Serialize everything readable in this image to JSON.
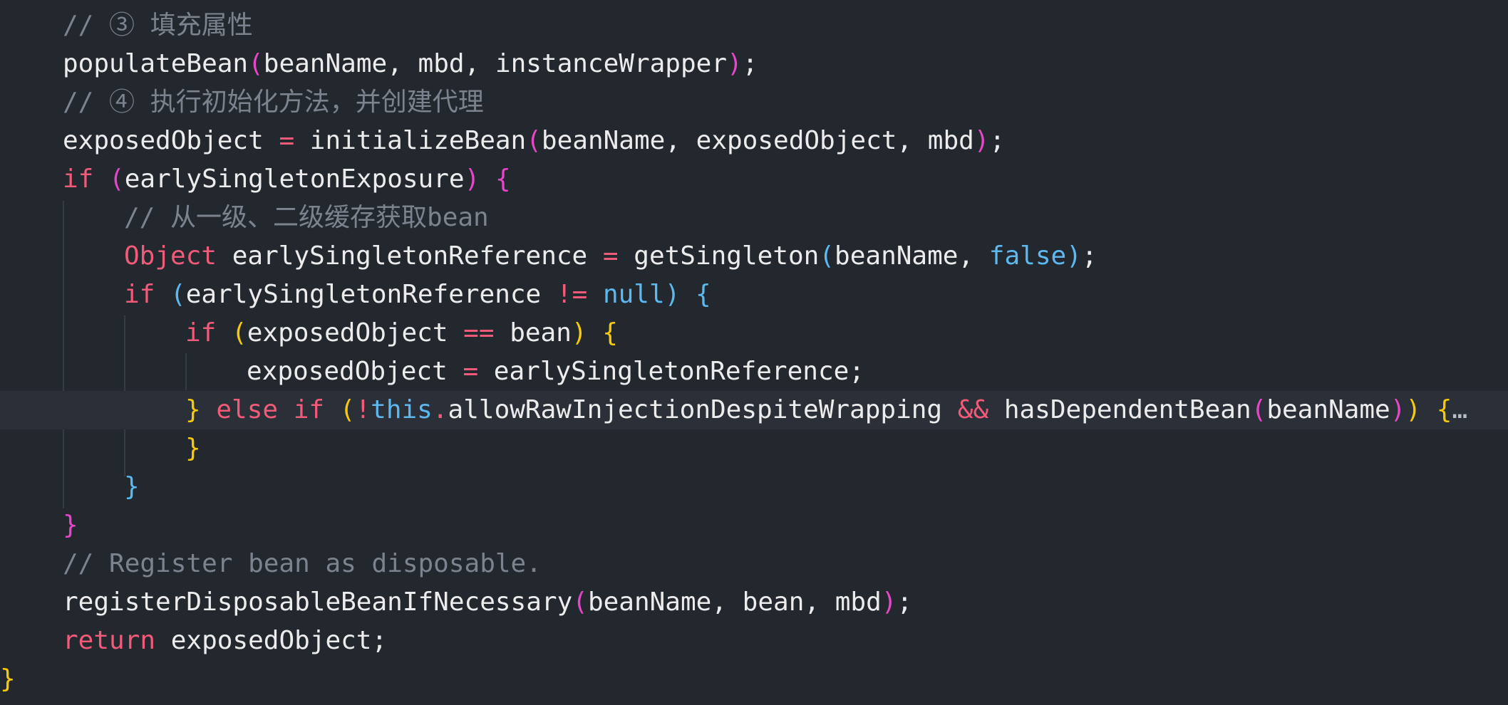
{
  "colors": {
    "background": "#23272e",
    "keyword": "#f25a79",
    "text": "#ececec",
    "comment": "#7c838f",
    "literal_blue": "#5cb8ef",
    "bracket_pink": "#e646c8",
    "bracket_yellow": "#f6c90e"
  },
  "code": {
    "lines": [
      {
        "indent": 88,
        "tokens": [
          {
            "t": "// ③ 填充属性",
            "c": "comment"
          }
        ]
      },
      {
        "indent": 88,
        "tokens": [
          {
            "t": "populateBean",
            "c": "default"
          },
          {
            "t": "(",
            "c": "pink"
          },
          {
            "t": "beanName, mbd, instanceWrapper",
            "c": "default"
          },
          {
            "t": ")",
            "c": "pink"
          },
          {
            "t": ";",
            "c": "default"
          }
        ]
      },
      {
        "indent": 88,
        "tokens": [
          {
            "t": "// ④ 执行初始化方法，并创建代理",
            "c": "comment"
          }
        ]
      },
      {
        "indent": 88,
        "tokens": [
          {
            "t": "exposedObject ",
            "c": "default"
          },
          {
            "t": "=",
            "c": "keyword"
          },
          {
            "t": " initializeBean",
            "c": "default"
          },
          {
            "t": "(",
            "c": "pink"
          },
          {
            "t": "beanName, exposedObject, mbd",
            "c": "default"
          },
          {
            "t": ")",
            "c": "pink"
          },
          {
            "t": ";",
            "c": "default"
          }
        ]
      },
      {
        "indent": 88,
        "tokens": [
          {
            "t": "if",
            "c": "keyword"
          },
          {
            "t": " ",
            "c": "default"
          },
          {
            "t": "(",
            "c": "pink"
          },
          {
            "t": "earlySingletonExposure",
            "c": "default"
          },
          {
            "t": ")",
            "c": "pink"
          },
          {
            "t": " ",
            "c": "default"
          },
          {
            "t": "{",
            "c": "pink"
          }
        ]
      },
      {
        "indent": 174,
        "tokens": [
          {
            "t": "// 从一级、二级缓存获取bean",
            "c": "comment"
          }
        ]
      },
      {
        "indent": 174,
        "tokens": [
          {
            "t": "Object",
            "c": "keyword"
          },
          {
            "t": " earlySingletonReference ",
            "c": "default"
          },
          {
            "t": "=",
            "c": "keyword"
          },
          {
            "t": " getSingleton",
            "c": "default"
          },
          {
            "t": "(",
            "c": "blue"
          },
          {
            "t": "beanName, ",
            "c": "default"
          },
          {
            "t": "false",
            "c": "blue"
          },
          {
            "t": ")",
            "c": "blue"
          },
          {
            "t": ";",
            "c": "default"
          }
        ]
      },
      {
        "indent": 174,
        "tokens": [
          {
            "t": "if",
            "c": "keyword"
          },
          {
            "t": " ",
            "c": "default"
          },
          {
            "t": "(",
            "c": "blue"
          },
          {
            "t": "earlySingletonReference ",
            "c": "default"
          },
          {
            "t": "!=",
            "c": "keyword"
          },
          {
            "t": " ",
            "c": "default"
          },
          {
            "t": "null",
            "c": "blue"
          },
          {
            "t": ")",
            "c": "blue"
          },
          {
            "t": " ",
            "c": "default"
          },
          {
            "t": "{",
            "c": "blue"
          }
        ]
      },
      {
        "indent": 260,
        "tokens": [
          {
            "t": "if",
            "c": "keyword"
          },
          {
            "t": " ",
            "c": "default"
          },
          {
            "t": "(",
            "c": "yellow"
          },
          {
            "t": "exposedObject ",
            "c": "default"
          },
          {
            "t": "==",
            "c": "keyword"
          },
          {
            "t": " bean",
            "c": "default"
          },
          {
            "t": ")",
            "c": "yellow"
          },
          {
            "t": " ",
            "c": "default"
          },
          {
            "t": "{",
            "c": "yellow"
          }
        ]
      },
      {
        "indent": 346,
        "tokens": [
          {
            "t": "exposedObject ",
            "c": "default"
          },
          {
            "t": "=",
            "c": "keyword"
          },
          {
            "t": " earlySingletonReference;",
            "c": "default"
          }
        ]
      },
      {
        "indent": 260,
        "highlight": true,
        "tokens": [
          {
            "t": "}",
            "c": "yellow"
          },
          {
            "t": " ",
            "c": "default"
          },
          {
            "t": "else if",
            "c": "keyword"
          },
          {
            "t": " ",
            "c": "default"
          },
          {
            "t": "(",
            "c": "yellow"
          },
          {
            "t": "!",
            "c": "keyword"
          },
          {
            "t": "this",
            "c": "blue"
          },
          {
            "t": ".",
            "c": "keyword"
          },
          {
            "t": "allowRawInjectionDespiteWrapping ",
            "c": "default"
          },
          {
            "t": "&&",
            "c": "keyword"
          },
          {
            "t": " hasDependentBean",
            "c": "default"
          },
          {
            "t": "(",
            "c": "pink"
          },
          {
            "t": "beanName",
            "c": "default"
          },
          {
            "t": ")",
            "c": "pink"
          },
          {
            "t": ")",
            "c": "yellow"
          },
          {
            "t": " ",
            "c": "default"
          },
          {
            "t": "{",
            "c": "yellow"
          },
          {
            "t": "…",
            "c": "ellipsis"
          }
        ]
      },
      {
        "indent": 260,
        "tokens": [
          {
            "t": "}",
            "c": "yellow"
          }
        ]
      },
      {
        "indent": 174,
        "tokens": [
          {
            "t": "}",
            "c": "blue"
          }
        ]
      },
      {
        "indent": 88,
        "tokens": [
          {
            "t": "}",
            "c": "pink"
          }
        ]
      },
      {
        "indent": 88,
        "tokens": [
          {
            "t": "// Register bean as disposable.",
            "c": "comment"
          }
        ]
      },
      {
        "indent": 88,
        "tokens": [
          {
            "t": "registerDisposableBeanIfNecessary",
            "c": "default"
          },
          {
            "t": "(",
            "c": "pink"
          },
          {
            "t": "beanName, bean, mbd",
            "c": "default"
          },
          {
            "t": ")",
            "c": "pink"
          },
          {
            "t": ";",
            "c": "default"
          }
        ]
      },
      {
        "indent": 88,
        "tokens": [
          {
            "t": "return",
            "c": "keyword"
          },
          {
            "t": " exposedObject;",
            "c": "default"
          }
        ]
      },
      {
        "indent": 0,
        "tokens": [
          {
            "t": "}",
            "c": "yellow"
          }
        ]
      }
    ]
  }
}
